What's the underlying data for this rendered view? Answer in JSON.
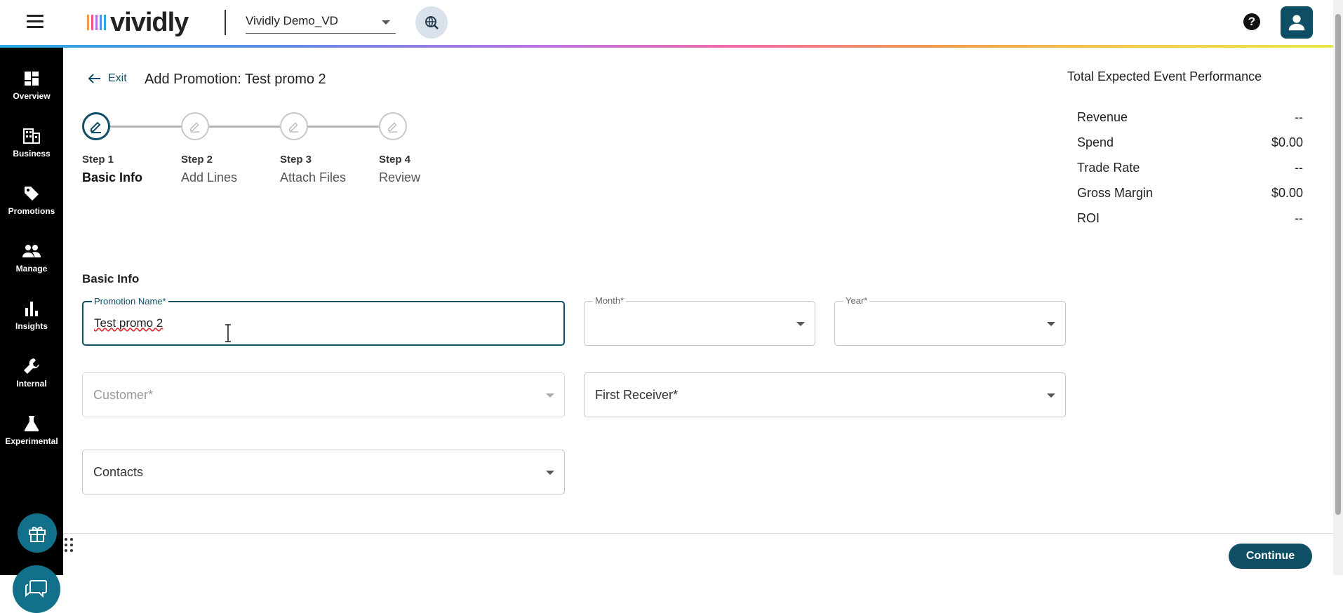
{
  "header": {
    "logo_text": "vividly",
    "account_select_value": "Vividly Demo_VD",
    "brand_gradient": [
      "#2aa7e0",
      "#b872e6",
      "#f06aa8",
      "#f2994a",
      "#e8e84a"
    ]
  },
  "sidebar": {
    "items": [
      {
        "label": "Overview",
        "icon": "overview-icon"
      },
      {
        "label": "Business",
        "icon": "building-icon"
      },
      {
        "label": "Promotions",
        "icon": "tag-icon"
      },
      {
        "label": "Manage",
        "icon": "people-icon"
      },
      {
        "label": "Insights",
        "icon": "bar-chart-icon"
      },
      {
        "label": "Internal",
        "icon": "wrench-icon"
      },
      {
        "label": "Experimental",
        "icon": "flask-icon"
      }
    ]
  },
  "page": {
    "exit_label": "Exit",
    "title": "Add Promotion: Test promo 2"
  },
  "stepper": {
    "steps": [
      {
        "num": "Step 1",
        "name": "Basic Info",
        "active": true
      },
      {
        "num": "Step 2",
        "name": "Add Lines",
        "active": false
      },
      {
        "num": "Step 3",
        "name": "Attach Files",
        "active": false
      },
      {
        "num": "Step 4",
        "name": "Review",
        "active": false
      }
    ]
  },
  "performance": {
    "title": "Total Expected Event Performance",
    "rows": [
      {
        "label": "Revenue",
        "value": "--"
      },
      {
        "label": "Spend",
        "value": "$0.00"
      },
      {
        "label": "Trade Rate",
        "value": "--"
      },
      {
        "label": "Gross Margin",
        "value": "$0.00"
      },
      {
        "label": "ROI",
        "value": "--"
      }
    ]
  },
  "form": {
    "section_title": "Basic Info",
    "promotion_name": {
      "label": "Promotion Name*",
      "value": "Test promo 2"
    },
    "month": {
      "label": "Month*",
      "value": ""
    },
    "year": {
      "label": "Year*",
      "value": ""
    },
    "customer": {
      "placeholder": "Customer*"
    },
    "first_receiver": {
      "placeholder": "First Receiver*"
    },
    "contacts": {
      "placeholder": "Contacts"
    }
  },
  "footer": {
    "continue_label": "Continue"
  },
  "colors": {
    "accent": "#0e4f66",
    "sidebar_bg": "#000000",
    "button_teal": "#13708a"
  }
}
